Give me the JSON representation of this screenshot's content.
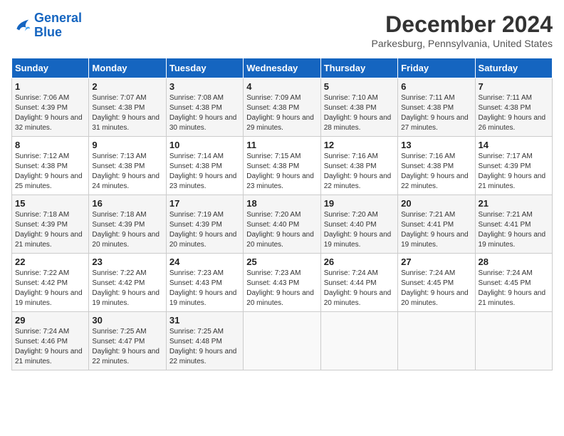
{
  "header": {
    "logo_line1": "General",
    "logo_line2": "Blue",
    "month": "December 2024",
    "location": "Parkesburg, Pennsylvania, United States"
  },
  "days_of_week": [
    "Sunday",
    "Monday",
    "Tuesday",
    "Wednesday",
    "Thursday",
    "Friday",
    "Saturday"
  ],
  "weeks": [
    [
      {
        "day": "1",
        "sunrise": "Sunrise: 7:06 AM",
        "sunset": "Sunset: 4:39 PM",
        "daylight": "Daylight: 9 hours and 32 minutes."
      },
      {
        "day": "2",
        "sunrise": "Sunrise: 7:07 AM",
        "sunset": "Sunset: 4:38 PM",
        "daylight": "Daylight: 9 hours and 31 minutes."
      },
      {
        "day": "3",
        "sunrise": "Sunrise: 7:08 AM",
        "sunset": "Sunset: 4:38 PM",
        "daylight": "Daylight: 9 hours and 30 minutes."
      },
      {
        "day": "4",
        "sunrise": "Sunrise: 7:09 AM",
        "sunset": "Sunset: 4:38 PM",
        "daylight": "Daylight: 9 hours and 29 minutes."
      },
      {
        "day": "5",
        "sunrise": "Sunrise: 7:10 AM",
        "sunset": "Sunset: 4:38 PM",
        "daylight": "Daylight: 9 hours and 28 minutes."
      },
      {
        "day": "6",
        "sunrise": "Sunrise: 7:11 AM",
        "sunset": "Sunset: 4:38 PM",
        "daylight": "Daylight: 9 hours and 27 minutes."
      },
      {
        "day": "7",
        "sunrise": "Sunrise: 7:11 AM",
        "sunset": "Sunset: 4:38 PM",
        "daylight": "Daylight: 9 hours and 26 minutes."
      }
    ],
    [
      {
        "day": "8",
        "sunrise": "Sunrise: 7:12 AM",
        "sunset": "Sunset: 4:38 PM",
        "daylight": "Daylight: 9 hours and 25 minutes."
      },
      {
        "day": "9",
        "sunrise": "Sunrise: 7:13 AM",
        "sunset": "Sunset: 4:38 PM",
        "daylight": "Daylight: 9 hours and 24 minutes."
      },
      {
        "day": "10",
        "sunrise": "Sunrise: 7:14 AM",
        "sunset": "Sunset: 4:38 PM",
        "daylight": "Daylight: 9 hours and 23 minutes."
      },
      {
        "day": "11",
        "sunrise": "Sunrise: 7:15 AM",
        "sunset": "Sunset: 4:38 PM",
        "daylight": "Daylight: 9 hours and 23 minutes."
      },
      {
        "day": "12",
        "sunrise": "Sunrise: 7:16 AM",
        "sunset": "Sunset: 4:38 PM",
        "daylight": "Daylight: 9 hours and 22 minutes."
      },
      {
        "day": "13",
        "sunrise": "Sunrise: 7:16 AM",
        "sunset": "Sunset: 4:38 PM",
        "daylight": "Daylight: 9 hours and 22 minutes."
      },
      {
        "day": "14",
        "sunrise": "Sunrise: 7:17 AM",
        "sunset": "Sunset: 4:39 PM",
        "daylight": "Daylight: 9 hours and 21 minutes."
      }
    ],
    [
      {
        "day": "15",
        "sunrise": "Sunrise: 7:18 AM",
        "sunset": "Sunset: 4:39 PM",
        "daylight": "Daylight: 9 hours and 21 minutes."
      },
      {
        "day": "16",
        "sunrise": "Sunrise: 7:18 AM",
        "sunset": "Sunset: 4:39 PM",
        "daylight": "Daylight: 9 hours and 20 minutes."
      },
      {
        "day": "17",
        "sunrise": "Sunrise: 7:19 AM",
        "sunset": "Sunset: 4:39 PM",
        "daylight": "Daylight: 9 hours and 20 minutes."
      },
      {
        "day": "18",
        "sunrise": "Sunrise: 7:20 AM",
        "sunset": "Sunset: 4:40 PM",
        "daylight": "Daylight: 9 hours and 20 minutes."
      },
      {
        "day": "19",
        "sunrise": "Sunrise: 7:20 AM",
        "sunset": "Sunset: 4:40 PM",
        "daylight": "Daylight: 9 hours and 19 minutes."
      },
      {
        "day": "20",
        "sunrise": "Sunrise: 7:21 AM",
        "sunset": "Sunset: 4:41 PM",
        "daylight": "Daylight: 9 hours and 19 minutes."
      },
      {
        "day": "21",
        "sunrise": "Sunrise: 7:21 AM",
        "sunset": "Sunset: 4:41 PM",
        "daylight": "Daylight: 9 hours and 19 minutes."
      }
    ],
    [
      {
        "day": "22",
        "sunrise": "Sunrise: 7:22 AM",
        "sunset": "Sunset: 4:42 PM",
        "daylight": "Daylight: 9 hours and 19 minutes."
      },
      {
        "day": "23",
        "sunrise": "Sunrise: 7:22 AM",
        "sunset": "Sunset: 4:42 PM",
        "daylight": "Daylight: 9 hours and 19 minutes."
      },
      {
        "day": "24",
        "sunrise": "Sunrise: 7:23 AM",
        "sunset": "Sunset: 4:43 PM",
        "daylight": "Daylight: 9 hours and 19 minutes."
      },
      {
        "day": "25",
        "sunrise": "Sunrise: 7:23 AM",
        "sunset": "Sunset: 4:43 PM",
        "daylight": "Daylight: 9 hours and 20 minutes."
      },
      {
        "day": "26",
        "sunrise": "Sunrise: 7:24 AM",
        "sunset": "Sunset: 4:44 PM",
        "daylight": "Daylight: 9 hours and 20 minutes."
      },
      {
        "day": "27",
        "sunrise": "Sunrise: 7:24 AM",
        "sunset": "Sunset: 4:45 PM",
        "daylight": "Daylight: 9 hours and 20 minutes."
      },
      {
        "day": "28",
        "sunrise": "Sunrise: 7:24 AM",
        "sunset": "Sunset: 4:45 PM",
        "daylight": "Daylight: 9 hours and 21 minutes."
      }
    ],
    [
      {
        "day": "29",
        "sunrise": "Sunrise: 7:24 AM",
        "sunset": "Sunset: 4:46 PM",
        "daylight": "Daylight: 9 hours and 21 minutes."
      },
      {
        "day": "30",
        "sunrise": "Sunrise: 7:25 AM",
        "sunset": "Sunset: 4:47 PM",
        "daylight": "Daylight: 9 hours and 22 minutes."
      },
      {
        "day": "31",
        "sunrise": "Sunrise: 7:25 AM",
        "sunset": "Sunset: 4:48 PM",
        "daylight": "Daylight: 9 hours and 22 minutes."
      },
      null,
      null,
      null,
      null
    ]
  ]
}
